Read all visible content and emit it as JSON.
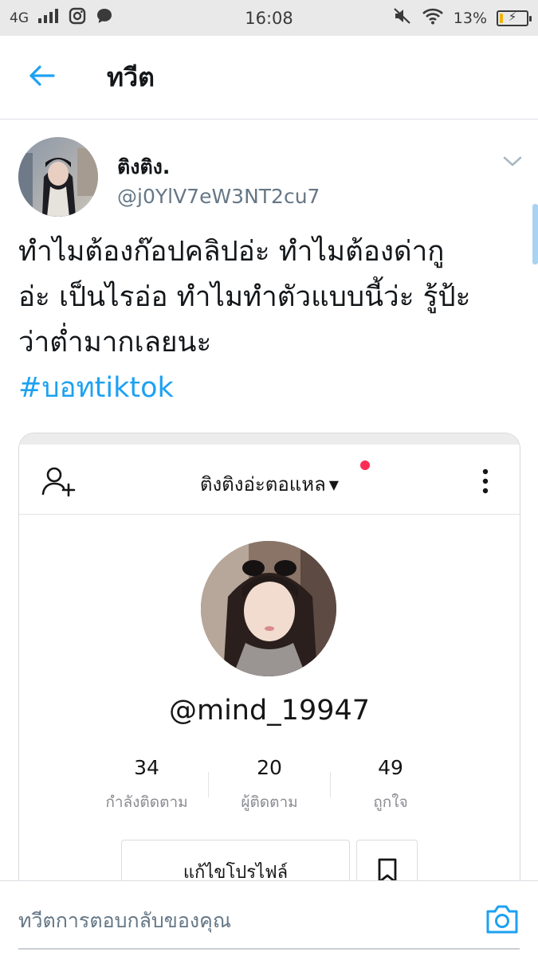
{
  "status_bar": {
    "network": "4G",
    "time": "16:08",
    "battery_percent": "13%",
    "battery_level": 0.13,
    "icons": [
      "signal-icon",
      "instagram-icon",
      "chat-bubble-icon",
      "mute-icon",
      "wifi-icon",
      "battery-icon"
    ]
  },
  "header": {
    "title": "ทวีต",
    "back_icon": "arrow-left-icon"
  },
  "tweet": {
    "display_name": "ติงติง.",
    "handle": "@j0YlV7eW3NT2cu7",
    "text_lines": [
      "ทำไมต้องก๊อปคลิปอ่ะ ทำไมต้องด่ากู",
      "อ่ะ เป็นไรอ่อ ทำไมทำตัวแบบนี้ว่ะ รู้ป้ะ",
      "ว่าต่ำมากเลยนะ"
    ],
    "hashtag": "#บอทtiktok",
    "accent_color": "#1da1f2"
  },
  "embedded_profile": {
    "title": "ติงติงอ่ะตอแหล",
    "username": "@mind_19947",
    "stats": [
      {
        "value": "34",
        "label": "กำลังติดตาม"
      },
      {
        "value": "20",
        "label": "ผู้ติดตาม"
      },
      {
        "value": "49",
        "label": "ถูกใจ"
      }
    ],
    "edit_button": "แก้ไขโปรไฟล์",
    "notification_color": "#fe2c55"
  },
  "reply": {
    "placeholder": "ทวีตการตอบกลับของคุณ",
    "camera_icon": "camera-icon"
  }
}
